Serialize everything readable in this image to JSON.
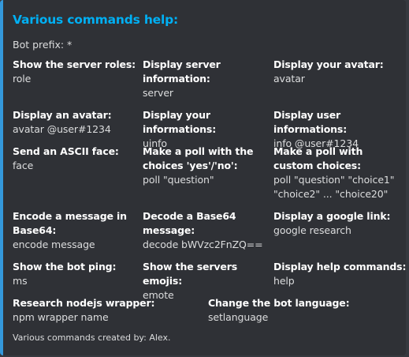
{
  "embed": {
    "title": "Various commands help:",
    "description": "Bot prefix: *",
    "footer": "Various commands created by: Alex.",
    "accent_color": "#3498db",
    "title_color": "#00b0f4",
    "fields": [
      {
        "name": "Show the server roles:",
        "value": "role"
      },
      {
        "name": "Display server information:",
        "value": "server"
      },
      {
        "name": "Display your avatar:",
        "value": "avatar"
      },
      {
        "name": "Display an avatar:",
        "value": "avatar @user#1234"
      },
      {
        "name": "Display your informations:",
        "value": "uinfo"
      },
      {
        "name": "Display user informations:",
        "value": "info @user#1234"
      },
      {
        "name": "Send an ASCII face:",
        "value": "face"
      },
      {
        "name": "Make a poll with the choices 'yes'/'no':",
        "value": "poll \"question\""
      },
      {
        "name": "Make a poll with custom choices:",
        "value": "poll \"question\" \"choice1\" \"choice2\" ... \"choice20\""
      },
      {
        "name": "Encode a message in Base64:",
        "value": "encode message"
      },
      {
        "name": "Decode a Base64 message:",
        "value": "decode bWVzc2FnZQ=="
      },
      {
        "name": "Display a google link:",
        "value": "google research"
      },
      {
        "name": "Show the bot ping:",
        "value": "ms"
      },
      {
        "name": "Show the servers emojis:",
        "value": "emote"
      },
      {
        "name": "Display help commands:",
        "value": "help"
      },
      {
        "name": "Research nodejs wrapper:",
        "value": "npm wrapper name"
      },
      {
        "name": "Change the bot language:",
        "value": "setlanguage"
      }
    ]
  }
}
